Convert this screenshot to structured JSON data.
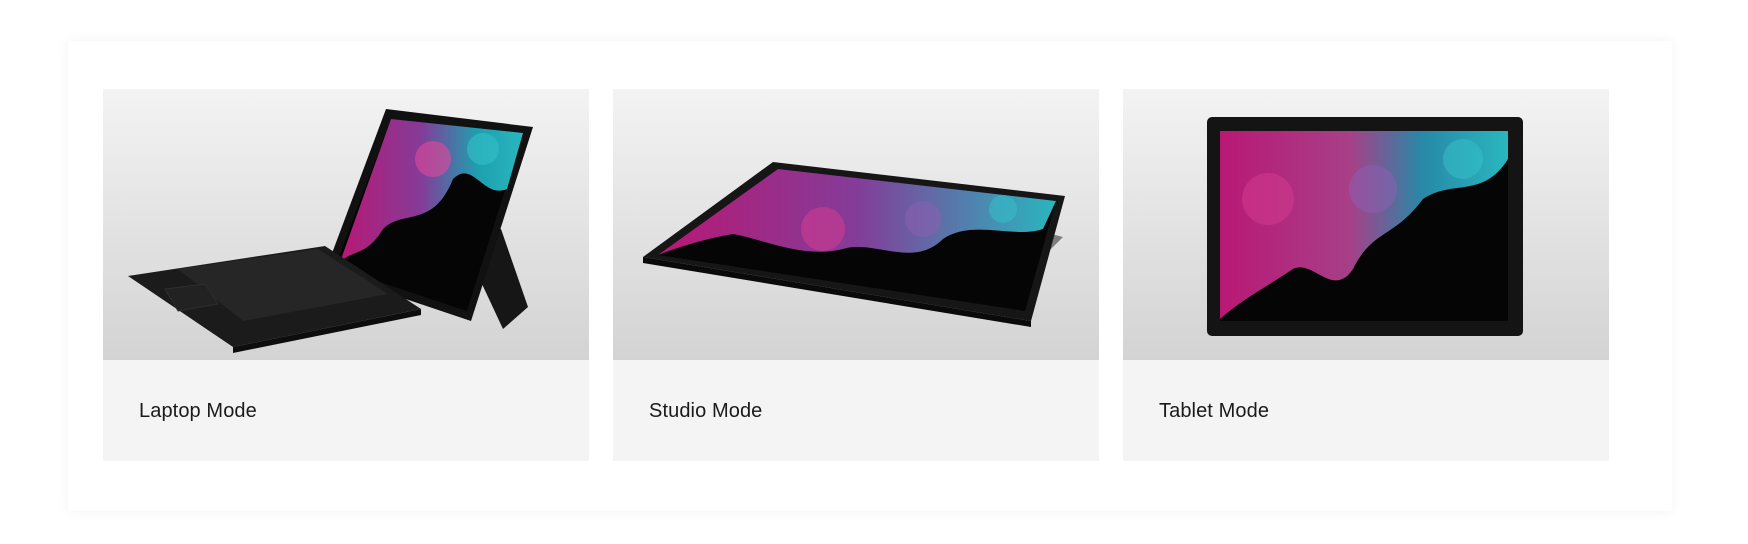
{
  "cards": [
    {
      "label": "Laptop Mode",
      "image_icon": "laptop-mode-illustration"
    },
    {
      "label": "Studio Mode",
      "image_icon": "studio-mode-illustration"
    },
    {
      "label": "Tablet Mode",
      "image_icon": "tablet-mode-illustration"
    }
  ],
  "colors": {
    "card_background": "#f4f4f4",
    "image_background_top": "#f3f3f3",
    "image_background_bottom": "#d3d3d3",
    "device_body": "#141414",
    "label_text": "#1a1a1a"
  }
}
